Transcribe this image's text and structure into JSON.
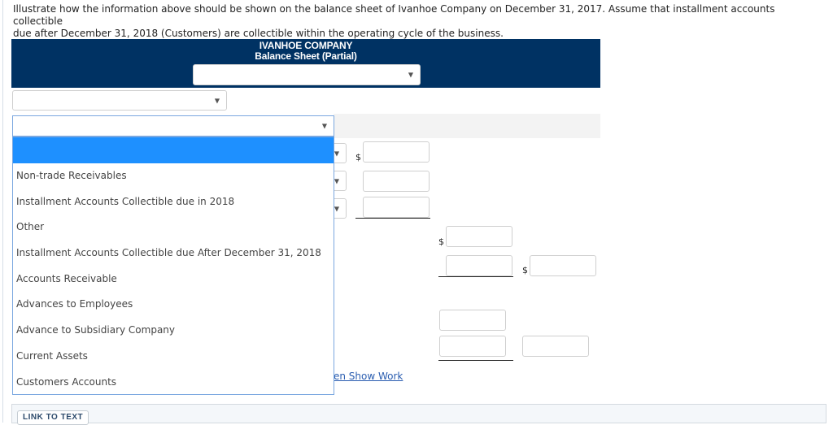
{
  "prompt": {
    "line1": "Illustrate how the information above should be shown on the balance sheet of Ivanhoe Company on December 31, 2017. Assume that installment accounts collectible",
    "line2": "due after December 31, 2018 (Customers) are collectible within the operating cycle of the business."
  },
  "statement": {
    "company": "IVANHOE COMPANY",
    "title": "Balance Sheet (Partial)",
    "date_select_value": ""
  },
  "rows": {
    "section_select_value": "",
    "open_select_value": ""
  },
  "currency_symbol": "$",
  "dropdown": {
    "options": [
      "",
      "Non-trade Receivables",
      "Installment Accounts Collectible due in 2018",
      "Other",
      "Installment Accounts Collectible due After December 31, 2018",
      "Accounts Receivable",
      "Advances to Employees",
      "Advance to Subsidiary Company",
      "Current Assets",
      "Customers Accounts"
    ],
    "highlighted_index": 0
  },
  "links": {
    "show_work": "en Show Work",
    "link_to_text": "LINK TO TEXT"
  },
  "colors": {
    "header_bg": "#003263",
    "highlight": "#1e90ff",
    "link": "#2a5db0"
  }
}
